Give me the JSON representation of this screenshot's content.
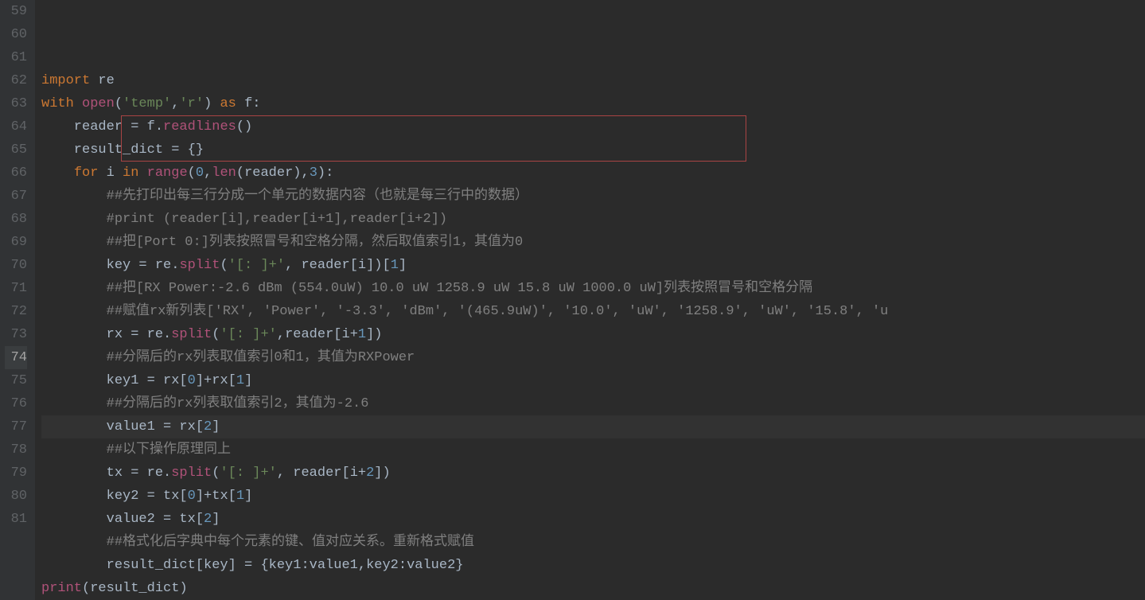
{
  "lines": [
    {
      "n": 59,
      "tokens": [
        [
          "kw",
          "import"
        ],
        [
          "var",
          " re"
        ]
      ]
    },
    {
      "n": 60,
      "tokens": [
        [
          "kw",
          "with"
        ],
        [
          "var",
          " "
        ],
        [
          "method",
          "open"
        ],
        [
          "paren",
          "("
        ],
        [
          "str",
          "'temp'"
        ],
        [
          "var",
          ","
        ],
        [
          "str",
          "'r'"
        ],
        [
          "paren",
          ")"
        ],
        [
          "var",
          " "
        ],
        [
          "kw",
          "as"
        ],
        [
          "var",
          " f:"
        ]
      ]
    },
    {
      "n": 61,
      "tokens": [
        [
          "var",
          "    reader = f."
        ],
        [
          "method",
          "readlines"
        ],
        [
          "paren",
          "()"
        ]
      ]
    },
    {
      "n": 62,
      "tokens": [
        [
          "var",
          "    result_dict = {}"
        ]
      ]
    },
    {
      "n": 63,
      "tokens": [
        [
          "var",
          "    "
        ],
        [
          "kw",
          "for"
        ],
        [
          "var",
          " i "
        ],
        [
          "kw",
          "in"
        ],
        [
          "var",
          " "
        ],
        [
          "method",
          "range"
        ],
        [
          "paren",
          "("
        ],
        [
          "num",
          "0"
        ],
        [
          "var",
          ","
        ],
        [
          "method",
          "len"
        ],
        [
          "paren",
          "("
        ],
        [
          "var",
          "reader"
        ],
        [
          "paren",
          ")"
        ],
        [
          "var",
          ","
        ],
        [
          "num",
          "3"
        ],
        [
          "paren",
          ")"
        ],
        [
          "var",
          ":"
        ]
      ]
    },
    {
      "n": 64,
      "tokens": [
        [
          "var",
          "        "
        ],
        [
          "comment",
          "##先打印出每三行分成一个单元的数据内容（也就是每三行中的数据）"
        ]
      ]
    },
    {
      "n": 65,
      "tokens": [
        [
          "var",
          "        "
        ],
        [
          "comment",
          "#print (reader[i],reader[i+1],reader[i+2])"
        ]
      ]
    },
    {
      "n": 66,
      "tokens": [
        [
          "var",
          "        "
        ],
        [
          "comment",
          "##把[Port 0:]列表按照冒号和空格分隔，然后取值索引1，其值为0"
        ]
      ]
    },
    {
      "n": 67,
      "tokens": [
        [
          "var",
          "        key = re."
        ],
        [
          "method",
          "split"
        ],
        [
          "paren",
          "("
        ],
        [
          "str",
          "'[: ]+'"
        ],
        [
          "var",
          ", reader[i])["
        ],
        [
          "num",
          "1"
        ],
        [
          "var",
          "]"
        ]
      ]
    },
    {
      "n": 68,
      "tokens": [
        [
          "var",
          "        "
        ],
        [
          "comment",
          "##把[RX Power:-2.6 dBm (554.0uW) 10.0 uW 1258.9 uW 15.8 uW 1000.0 uW]列表按照冒号和空格分隔"
        ]
      ]
    },
    {
      "n": 69,
      "tokens": [
        [
          "var",
          "        "
        ],
        [
          "comment",
          "##赋值rx新列表['RX', 'Power', '-3.3', 'dBm', '(465.9uW)', '10.0', 'uW', '1258.9', 'uW', '15.8', 'u"
        ]
      ]
    },
    {
      "n": 70,
      "tokens": [
        [
          "var",
          "        rx = re."
        ],
        [
          "method",
          "split"
        ],
        [
          "paren",
          "("
        ],
        [
          "str",
          "'[: ]+'"
        ],
        [
          "var",
          ",reader[i+"
        ],
        [
          "num",
          "1"
        ],
        [
          "var",
          "])"
        ]
      ]
    },
    {
      "n": 71,
      "tokens": [
        [
          "var",
          "        "
        ],
        [
          "comment",
          "##分隔后的rx列表取值索引0和1，其值为RXPower"
        ]
      ]
    },
    {
      "n": 72,
      "tokens": [
        [
          "var",
          "        key1 = rx["
        ],
        [
          "num",
          "0"
        ],
        [
          "var",
          "]+rx["
        ],
        [
          "num",
          "1"
        ],
        [
          "var",
          "]"
        ]
      ]
    },
    {
      "n": 73,
      "tokens": [
        [
          "var",
          "        "
        ],
        [
          "comment",
          "##分隔后的rx列表取值索引2，其值为-2.6"
        ]
      ]
    },
    {
      "n": 74,
      "tokens": [
        [
          "var",
          "        value1 = rx["
        ],
        [
          "num",
          "2"
        ],
        [
          "var",
          "]"
        ]
      ],
      "current": true
    },
    {
      "n": 75,
      "tokens": [
        [
          "var",
          "        "
        ],
        [
          "comment",
          "##以下操作原理同上"
        ]
      ]
    },
    {
      "n": 76,
      "tokens": [
        [
          "var",
          "        tx = re."
        ],
        [
          "method",
          "split"
        ],
        [
          "paren",
          "("
        ],
        [
          "str",
          "'[: ]+'"
        ],
        [
          "var",
          ", reader[i+"
        ],
        [
          "num",
          "2"
        ],
        [
          "var",
          "])"
        ]
      ]
    },
    {
      "n": 77,
      "tokens": [
        [
          "var",
          "        key2 = tx["
        ],
        [
          "num",
          "0"
        ],
        [
          "var",
          "]+tx["
        ],
        [
          "num",
          "1"
        ],
        [
          "var",
          "]"
        ]
      ]
    },
    {
      "n": 78,
      "tokens": [
        [
          "var",
          "        value2 = tx["
        ],
        [
          "num",
          "2"
        ],
        [
          "var",
          "]"
        ]
      ]
    },
    {
      "n": 79,
      "tokens": [
        [
          "var",
          "        "
        ],
        [
          "comment",
          "##格式化后字典中每个元素的键、值对应关系。重新格式赋值"
        ]
      ]
    },
    {
      "n": 80,
      "tokens": [
        [
          "var",
          "        result_dict[key] = {key1:value1,key2:value2}"
        ]
      ]
    },
    {
      "n": 81,
      "tokens": [
        [
          "method",
          "print"
        ],
        [
          "paren",
          "("
        ],
        [
          "var",
          "result_dict"
        ],
        [
          "paren",
          ")"
        ]
      ]
    }
  ]
}
